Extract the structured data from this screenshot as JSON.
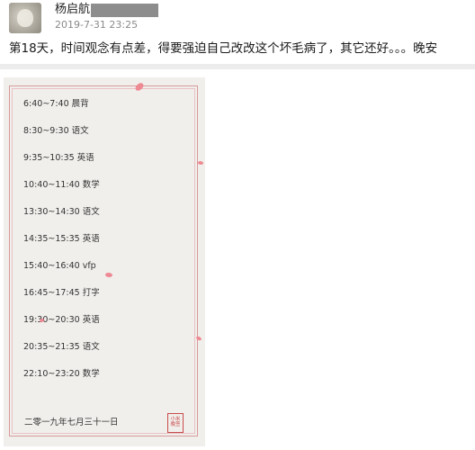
{
  "post": {
    "username": "杨启航",
    "timestamp": "2019-7-31 23:25",
    "text": "第18天，时间观念有点差，得要强迫自己改改这个坏毛病了，其它还好。。。晚安"
  },
  "note_image": {
    "schedule": [
      {
        "time": "6:40~7:40",
        "task": "晨背"
      },
      {
        "time": "8:30~9:30",
        "task": "语文"
      },
      {
        "time": "9:35~10:35",
        "task": "英语"
      },
      {
        "time": "10:40~11:40",
        "task": "数学"
      },
      {
        "time": "13:30~14:30",
        "task": "语文"
      },
      {
        "time": "14:35~15:35",
        "task": "英语"
      },
      {
        "time": "15:40~16:40",
        "task": "vfp"
      },
      {
        "time": "16:45~17:45",
        "task": "打字"
      },
      {
        "time": "19:30~20:30",
        "task": "英语"
      },
      {
        "time": "20:35~21:35",
        "task": "语文"
      },
      {
        "time": "22:10~23:20",
        "task": "数学"
      }
    ],
    "date": "二零一九年七月三十一日",
    "seal": {
      "line1": "小米",
      "line2": "晚签"
    }
  },
  "colors": {
    "frame": "#d79a9a",
    "petal": "#ee8a93",
    "seal": "#c84a4a",
    "redaction": "#8d8d8d"
  }
}
